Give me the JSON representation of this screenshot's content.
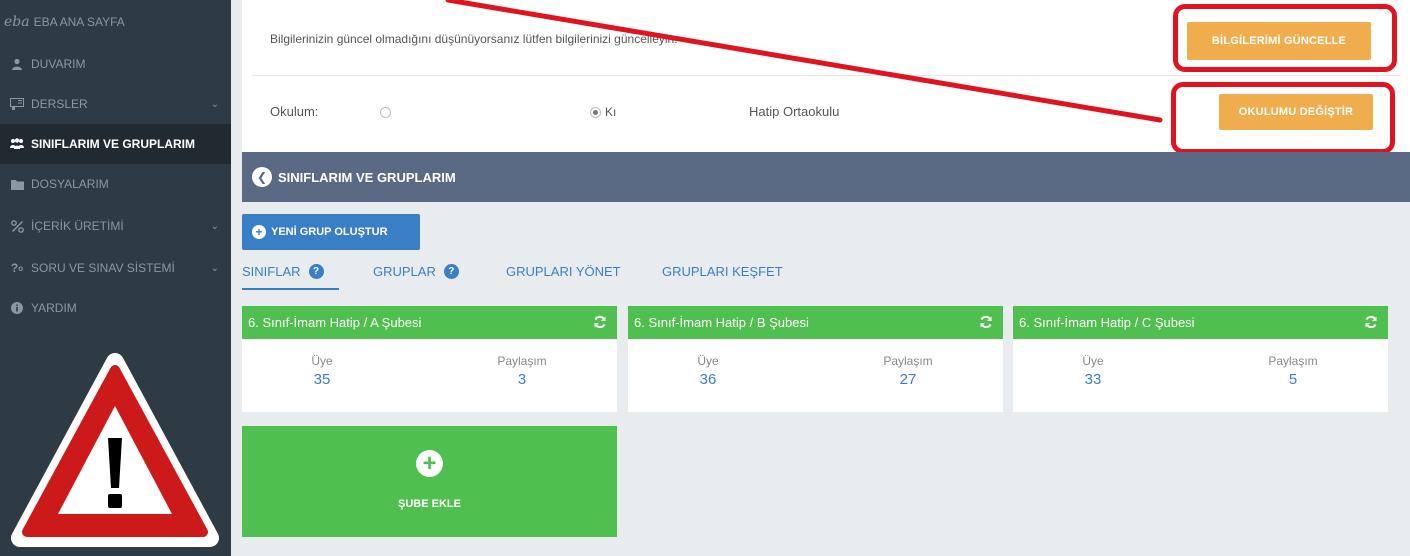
{
  "sidebar": {
    "items": [
      {
        "label": "EBA ANA SAYFA",
        "icon": "eba-logo-icon",
        "logo_text": "eba"
      },
      {
        "label": "DUVARIM",
        "icon": "user-icon"
      },
      {
        "label": "DERSLER",
        "icon": "board-icon",
        "chevron": "⌄"
      },
      {
        "label": "SINIFLARIM VE GRUPLARIM",
        "icon": "users-group-icon",
        "active": true
      },
      {
        "label": "DOSYALARIM",
        "icon": "folder-icon"
      },
      {
        "label": "İÇERİK ÜRETİMİ",
        "icon": "percent-icon",
        "chevron": "⌄"
      },
      {
        "label": "SORU VE SINAV SİSTEMİ",
        "icon": "question-icon",
        "chevron": "⌄"
      },
      {
        "label": "YARDIM",
        "icon": "info-icon"
      }
    ]
  },
  "info": {
    "message": "Bilgilerinizin güncel olmadığını düşünüyorsanız lütfen bilgilerinizi güncelleyin.",
    "update_button": "BİLGİLERİMİ GÜNCELLE",
    "school_label": "Okulum:",
    "radio2_label": "Kı",
    "school_name": "Hatip Ortaokulu",
    "change_school_button": "OKULUMU DEĞİŞTİR"
  },
  "section": {
    "title": "SINIFLARIM VE GRUPLARIM",
    "new_group_button": "YENİ GRUP OLUŞTUR"
  },
  "tabs": [
    {
      "label": "SINIFLAR",
      "help": "?"
    },
    {
      "label": "GRUPLAR",
      "help": "?"
    },
    {
      "label": "GRUPLARI YÖNET"
    },
    {
      "label": "GRUPLARI KEŞFET"
    }
  ],
  "cards": [
    {
      "title": "6. Sınıf-İmam Hatip / A Şubesi",
      "members_label": "Üye",
      "members": "35",
      "shares_label": "Paylaşım",
      "shares": "3"
    },
    {
      "title": "6. Sınıf-İmam Hatip / B Şubesi",
      "members_label": "Üye",
      "members": "36",
      "shares_label": "Paylaşım",
      "shares": "27"
    },
    {
      "title": "6. Sınıf-İmam Hatip / C Şubesi",
      "members_label": "Üye",
      "members": "33",
      "shares_label": "Paylaşım",
      "shares": "5"
    }
  ],
  "add_branch": {
    "label": "ŞUBE EKLE",
    "plus": "+"
  },
  "colors": {
    "sidebar_bg": "#2e3a44",
    "header_bar": "#5a6a85",
    "primary_blue": "#3a7ec6",
    "card_green": "#4fc04f",
    "button_orange": "#f0ad4e",
    "highlight_red": "#e0141e"
  }
}
